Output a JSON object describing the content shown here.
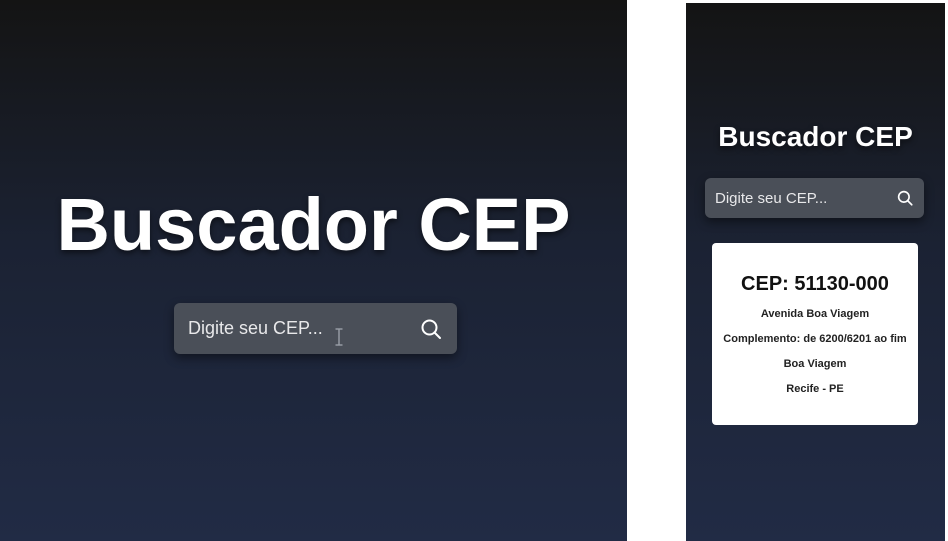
{
  "desktop": {
    "title": "Buscador CEP",
    "search": {
      "placeholder": "Digite seu CEP..."
    },
    "icons": {
      "search": "search-icon",
      "cursor": "text-cursor-icon"
    }
  },
  "mobile": {
    "title": "Buscador CEP",
    "search": {
      "placeholder": "Digite seu CEP..."
    },
    "result": {
      "cep": "CEP: 51130-000",
      "logradouro": "Avenida Boa Viagem",
      "complemento": "Complemento: de 6200/6201 ao fim",
      "bairro": "Boa Viagem",
      "cidade_uf": "Recife - PE"
    },
    "icons": {
      "search": "search-icon"
    }
  },
  "colors": {
    "background_top": "#141414",
    "background_bottom": "#212b45",
    "search_box": "#4a4f58",
    "card": "#ffffff",
    "text_light": "#ffffff"
  }
}
